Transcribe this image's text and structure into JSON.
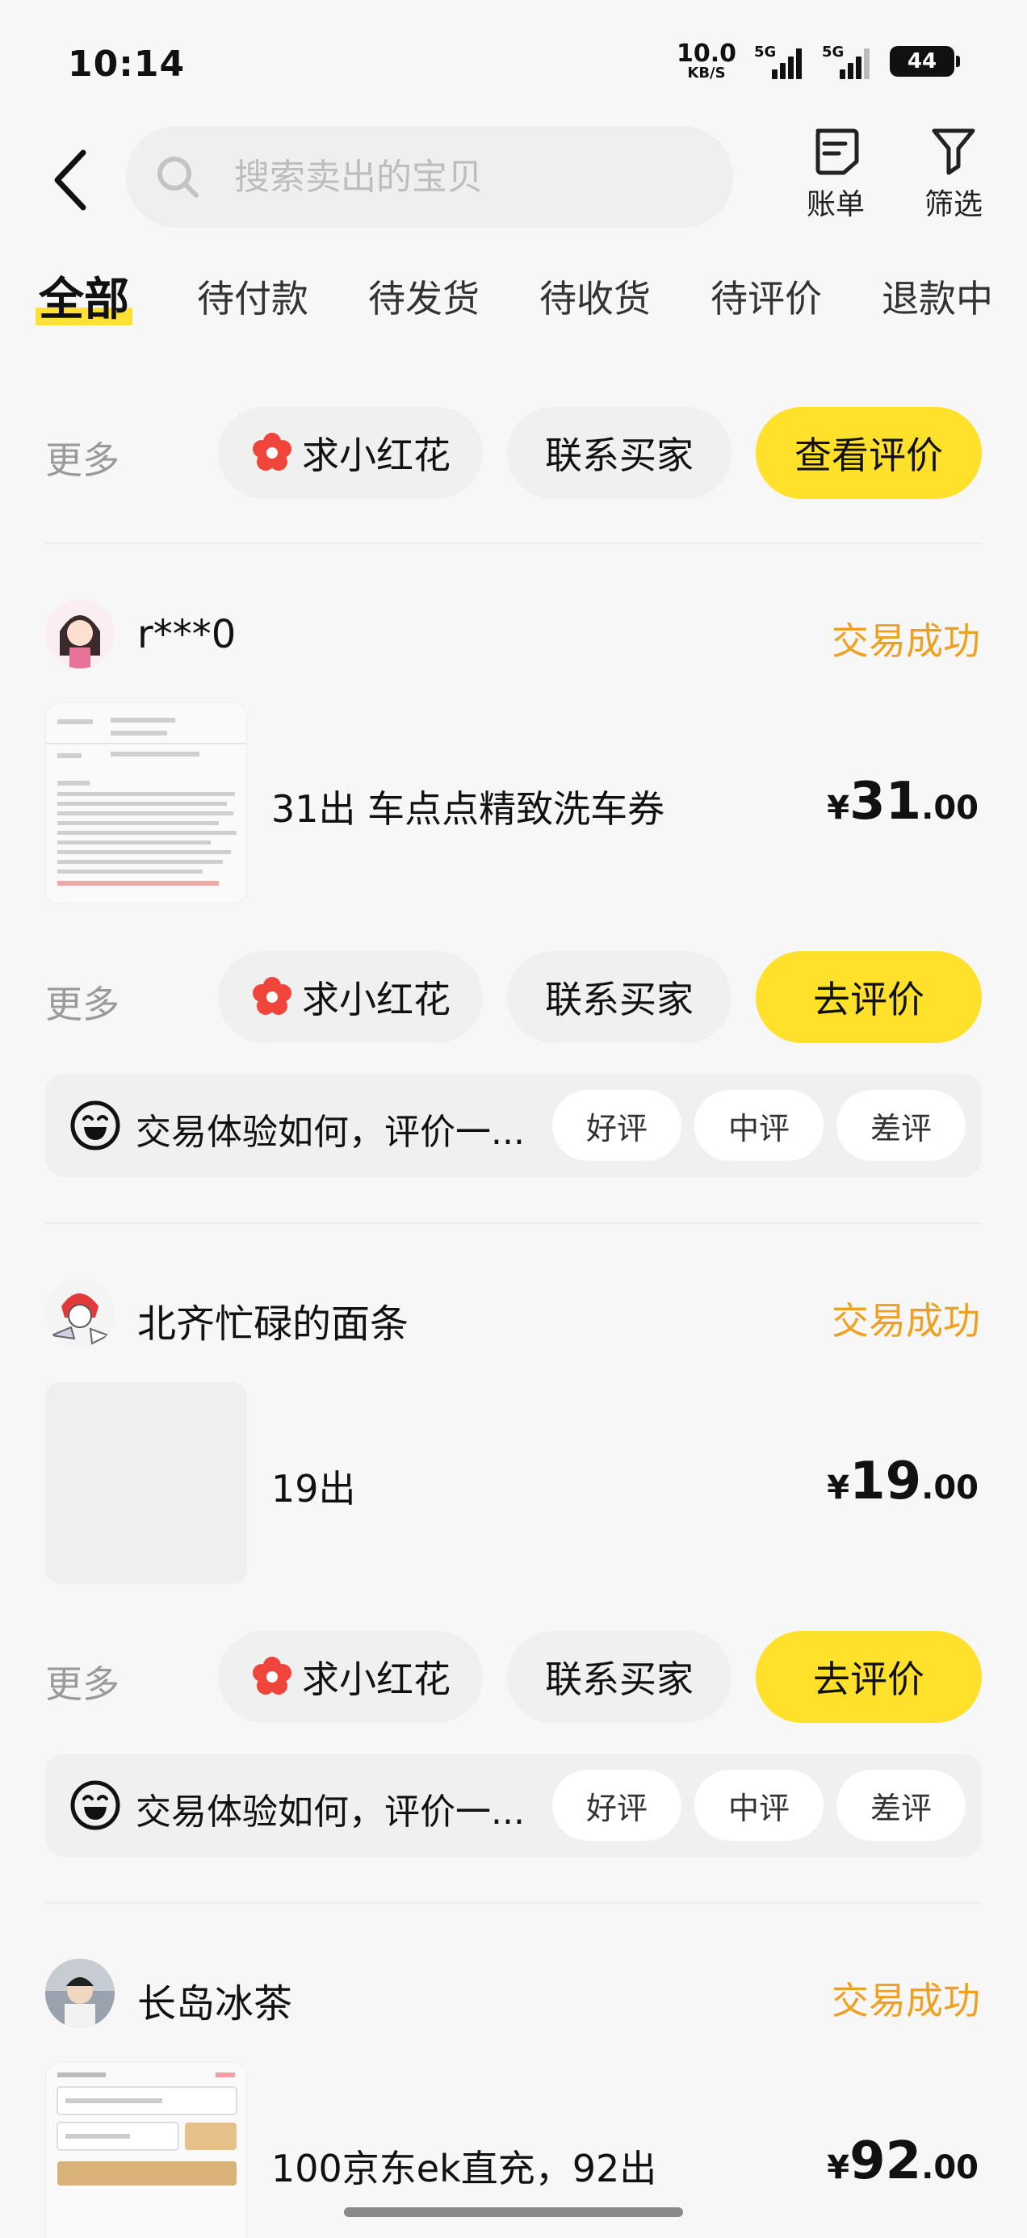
{
  "status_bar": {
    "time": "10:14",
    "net_speed_value": "10.0",
    "net_speed_unit": "KB/S",
    "signal1_label": "5G",
    "signal2_label": "5G",
    "battery_level": "44"
  },
  "header": {
    "search_placeholder": "搜索卖出的宝贝",
    "bill_label": "账单",
    "filter_label": "筛选"
  },
  "tabs": [
    {
      "label": "全部",
      "active": true
    },
    {
      "label": "待付款"
    },
    {
      "label": "待发货"
    },
    {
      "label": "待收货"
    },
    {
      "label": "待评价"
    },
    {
      "label": "退款中"
    }
  ],
  "top_actions": {
    "more": "更多",
    "flower": "求小红花",
    "contact": "联系买家",
    "primary": "查看评价"
  },
  "orders": [
    {
      "seller": "r***0",
      "status": "交易成功",
      "title": "31出 车点点精致洗车券",
      "price_currency": "¥",
      "price_int": "31",
      "price_dec": ".00",
      "actions": {
        "more": "更多",
        "flower": "求小红花",
        "contact": "联系买家",
        "primary": "去评价"
      },
      "review": {
        "question": "交易体验如何，评价一...",
        "good": "好评",
        "mid": "中评",
        "bad": "差评"
      }
    },
    {
      "seller": "北齐忙碌的面条",
      "status": "交易成功",
      "title": "19出",
      "price_currency": "¥",
      "price_int": "19",
      "price_dec": ".00",
      "actions": {
        "more": "更多",
        "flower": "求小红花",
        "contact": "联系买家",
        "primary": "去评价"
      },
      "review": {
        "question": "交易体验如何，评价一...",
        "good": "好评",
        "mid": "中评",
        "bad": "差评"
      }
    },
    {
      "seller": "长岛冰茶",
      "status": "交易成功",
      "title": "100京东ek直充，92出",
      "price_currency": "¥",
      "price_int": "92",
      "price_dec": ".00"
    }
  ],
  "colors": {
    "accent_yellow": "#ffe02a",
    "status_orange": "#f0a020",
    "flower_red": "#f0453a"
  }
}
